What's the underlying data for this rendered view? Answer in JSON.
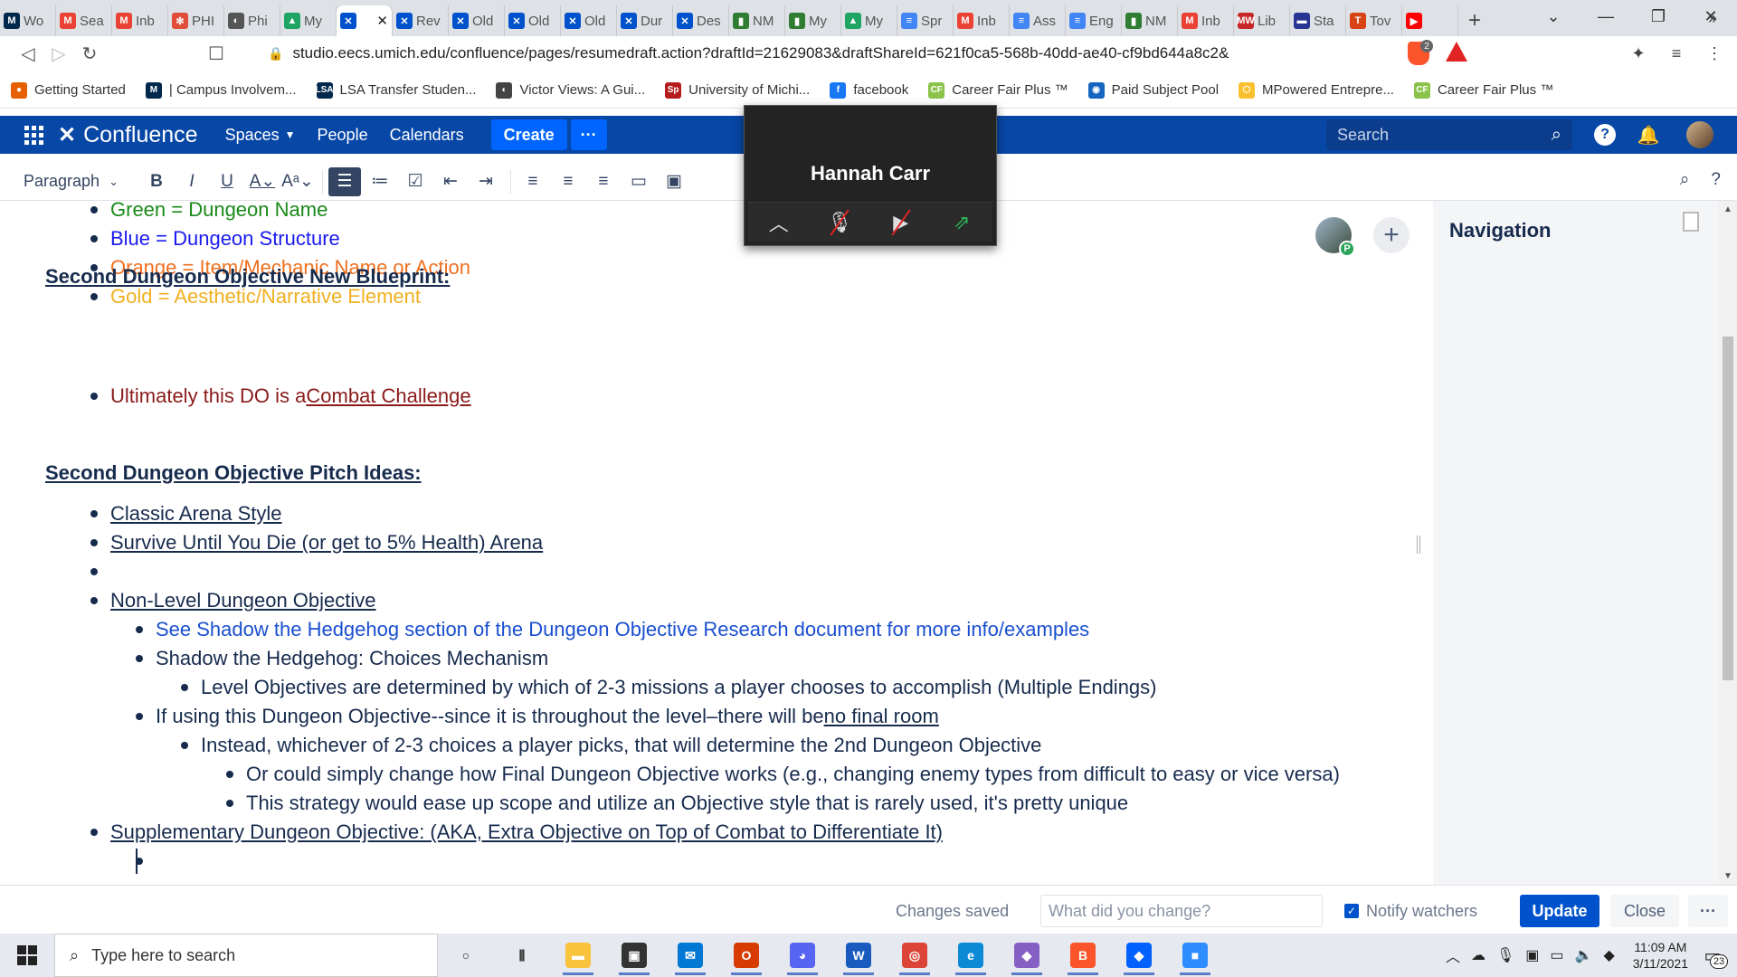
{
  "browser": {
    "tabs": [
      {
        "label": "Wo",
        "icon": "M",
        "color": "#00274c"
      },
      {
        "label": "Sea",
        "icon": "M",
        "color": "#ea4335"
      },
      {
        "label": "Inb",
        "icon": "M",
        "color": "#ea4335"
      },
      {
        "label": "PHI",
        "icon": "✻",
        "color": "#e04e39"
      },
      {
        "label": "Phi",
        "icon": "◐",
        "color": "#555555"
      },
      {
        "label": "My",
        "icon": "▲",
        "color": "#1fa463"
      },
      {
        "label": "",
        "icon": "✕",
        "color": "#0052cc",
        "active": true
      },
      {
        "label": "Rev",
        "icon": "✕",
        "color": "#0052cc"
      },
      {
        "label": "Old",
        "icon": "✕",
        "color": "#0052cc"
      },
      {
        "label": "Old",
        "icon": "✕",
        "color": "#0052cc"
      },
      {
        "label": "Old",
        "icon": "✕",
        "color": "#0052cc"
      },
      {
        "label": "Dur",
        "icon": "✕",
        "color": "#0052cc"
      },
      {
        "label": "Des",
        "icon": "✕",
        "color": "#0052cc"
      },
      {
        "label": "NM",
        "icon": "▮",
        "color": "#2e7d32"
      },
      {
        "label": "My",
        "icon": "▮",
        "color": "#2e7d32"
      },
      {
        "label": "My",
        "icon": "▲",
        "color": "#1fa463"
      },
      {
        "label": "Spr",
        "icon": "≡",
        "color": "#4285f4"
      },
      {
        "label": "Inb",
        "icon": "M",
        "color": "#ea4335"
      },
      {
        "label": "Ass",
        "icon": "≡",
        "color": "#4285f4"
      },
      {
        "label": "Eng",
        "icon": "≡",
        "color": "#4285f4"
      },
      {
        "label": "NM",
        "icon": "▮",
        "color": "#2e7d32"
      },
      {
        "label": "Inb",
        "icon": "M",
        "color": "#ea4335"
      },
      {
        "label": "Lib",
        "icon": "MW",
        "color": "#c62828"
      },
      {
        "label": "Sta",
        "icon": "▬",
        "color": "#283593"
      },
      {
        "label": "Tov",
        "icon": "T",
        "color": "#d84315"
      },
      {
        "label": "",
        "icon": "▶",
        "color": "#ff0000"
      }
    ],
    "url": "studio.eecs.umich.edu/confluence/pages/resumedraft.action?draftId=21629083&draftShareId=621f0ca5-568b-40dd-ae40-cf9bd644a8c2&",
    "brave_badge": "2",
    "bookmarks": [
      {
        "label": "Getting Started",
        "color": "#e66000",
        "icon": "●"
      },
      {
        "label": "| Campus Involvem...",
        "color": "#00274c",
        "icon": "M"
      },
      {
        "label": "LSA Transfer Studen...",
        "color": "#00274c",
        "icon": "LSA"
      },
      {
        "label": "Victor Views: A Gui...",
        "color": "#444444",
        "icon": "◐"
      },
      {
        "label": "University of Michi...",
        "color": "#b71c1c",
        "icon": "Sp"
      },
      {
        "label": "facebook",
        "color": "#1877f2",
        "icon": "f"
      },
      {
        "label": "Career Fair Plus ™",
        "color": "#8bc34a",
        "icon": "CF"
      },
      {
        "label": "Paid Subject Pool",
        "color": "#1565c0",
        "icon": "◉"
      },
      {
        "label": "MPowered Entrepre...",
        "color": "#fbc02d",
        "icon": "⬡"
      },
      {
        "label": "Career Fair Plus ™",
        "color": "#8bc34a",
        "icon": "CF"
      }
    ]
  },
  "confluence": {
    "logo": "Confluence",
    "nav": {
      "spaces": "Spaces",
      "people": "People",
      "calendars": "Calendars"
    },
    "create": "Create",
    "more": "···",
    "search_placeholder": "Search"
  },
  "toolbar": {
    "paragraph": "Paragraph",
    "buttons": [
      "B",
      "I",
      "U"
    ]
  },
  "zoom": {
    "participant": "Hannah Carr"
  },
  "document": {
    "legend": [
      {
        "text": "Green = Dungeon Name",
        "color": "#1a8a1a"
      },
      {
        "text": "Blue = Dungeon Structure",
        "color": "#1a1af0"
      },
      {
        "text": "Orange = Item/Mechanic Name or Action",
        "color": "#f07020"
      },
      {
        "text": "Gold = Aesthetic/Narrative Element",
        "color": "#f0b020"
      }
    ],
    "heading1": "Second Dungeon Objective New Blueprint:",
    "blueprint_prefix": "Ultimately this DO is a ",
    "blueprint_link": "Combat Challenge",
    "heading2": "Second Dungeon Objective Pitch Ideas:",
    "ideas": {
      "classic": "Classic Arena Style",
      "survive": "Survive Until You Die (or get to 5% Health) Arena",
      "nonlevel": "Non-Level Dungeon Objective",
      "see_shadow": "See Shadow the Hedgehog section of the Dungeon Objective Research document for more info/examples",
      "shadow_choices": "Shadow the Hedgehog: Choices Mechanism",
      "level_objectives": "Level Objectives are determined by which of 2-3 missions a player chooses to accomplish (Multiple Endings)",
      "if_using_prefix": "If using this Dungeon Objective--since it is throughout the level–there will be ",
      "no_final_room": "no final room",
      "instead": "Instead, whichever of 2-3 choices a player picks, that will determine the 2nd Dungeon Objective",
      "or_could": "Or could simply change how Final Dungeon Objective works (e.g., changing enemy types from difficult to easy or vice versa)",
      "this_strategy": "This strategy would ease up scope and utilize an Objective style that is rarely used, it's pretty unique",
      "supplementary": "Supplementary Dungeon Objective: (AKA, Extra Objective on Top of Combat to Differentiate It)"
    },
    "blueprint_color": "#8b1a1a",
    "see_color": "#1a4fd0",
    "collab_badge": "P"
  },
  "navigation": {
    "title": "Navigation"
  },
  "savebar": {
    "status": "Changes saved",
    "placeholder": "What did you change?",
    "notify": "Notify watchers",
    "update": "Update",
    "close": "Close",
    "more": "···"
  },
  "taskbar": {
    "search_placeholder": "Type here to search",
    "time": "11:09 AM",
    "date": "3/11/2021",
    "notifications": "23",
    "apps": [
      {
        "name": "task-view",
        "icon": "○",
        "color": "#222222",
        "bg": "transparent"
      },
      {
        "name": "multitask",
        "icon": "⫼",
        "color": "#222222",
        "bg": "transparent"
      },
      {
        "name": "file-explorer",
        "icon": "▬",
        "color": "#fff",
        "bg": "#f9c33c"
      },
      {
        "name": "store",
        "icon": "▣",
        "color": "#fff",
        "bg": "#333333"
      },
      {
        "name": "mail",
        "icon": "✉",
        "color": "#fff",
        "bg": "#0078d4"
      },
      {
        "name": "office",
        "icon": "O",
        "color": "#fff",
        "bg": "#d83b01"
      },
      {
        "name": "discord",
        "icon": "◕",
        "color": "#fff",
        "bg": "#5865f2"
      },
      {
        "name": "word",
        "icon": "W",
        "color": "#fff",
        "bg": "#185abd"
      },
      {
        "name": "chrome",
        "icon": "◎",
        "color": "#fff",
        "bg": "#db4437"
      },
      {
        "name": "edge",
        "icon": "e",
        "color": "#fff",
        "bg": "#0c8ad6"
      },
      {
        "name": "visual-studio",
        "icon": "◆",
        "color": "#fff",
        "bg": "#865fc5"
      },
      {
        "name": "brave",
        "icon": "B",
        "color": "#fff",
        "bg": "#fb542b"
      },
      {
        "name": "dropbox",
        "icon": "◆",
        "color": "#fff",
        "bg": "#0061ff"
      },
      {
        "name": "zoom",
        "icon": "■",
        "color": "#fff",
        "bg": "#2d8cff"
      }
    ]
  }
}
